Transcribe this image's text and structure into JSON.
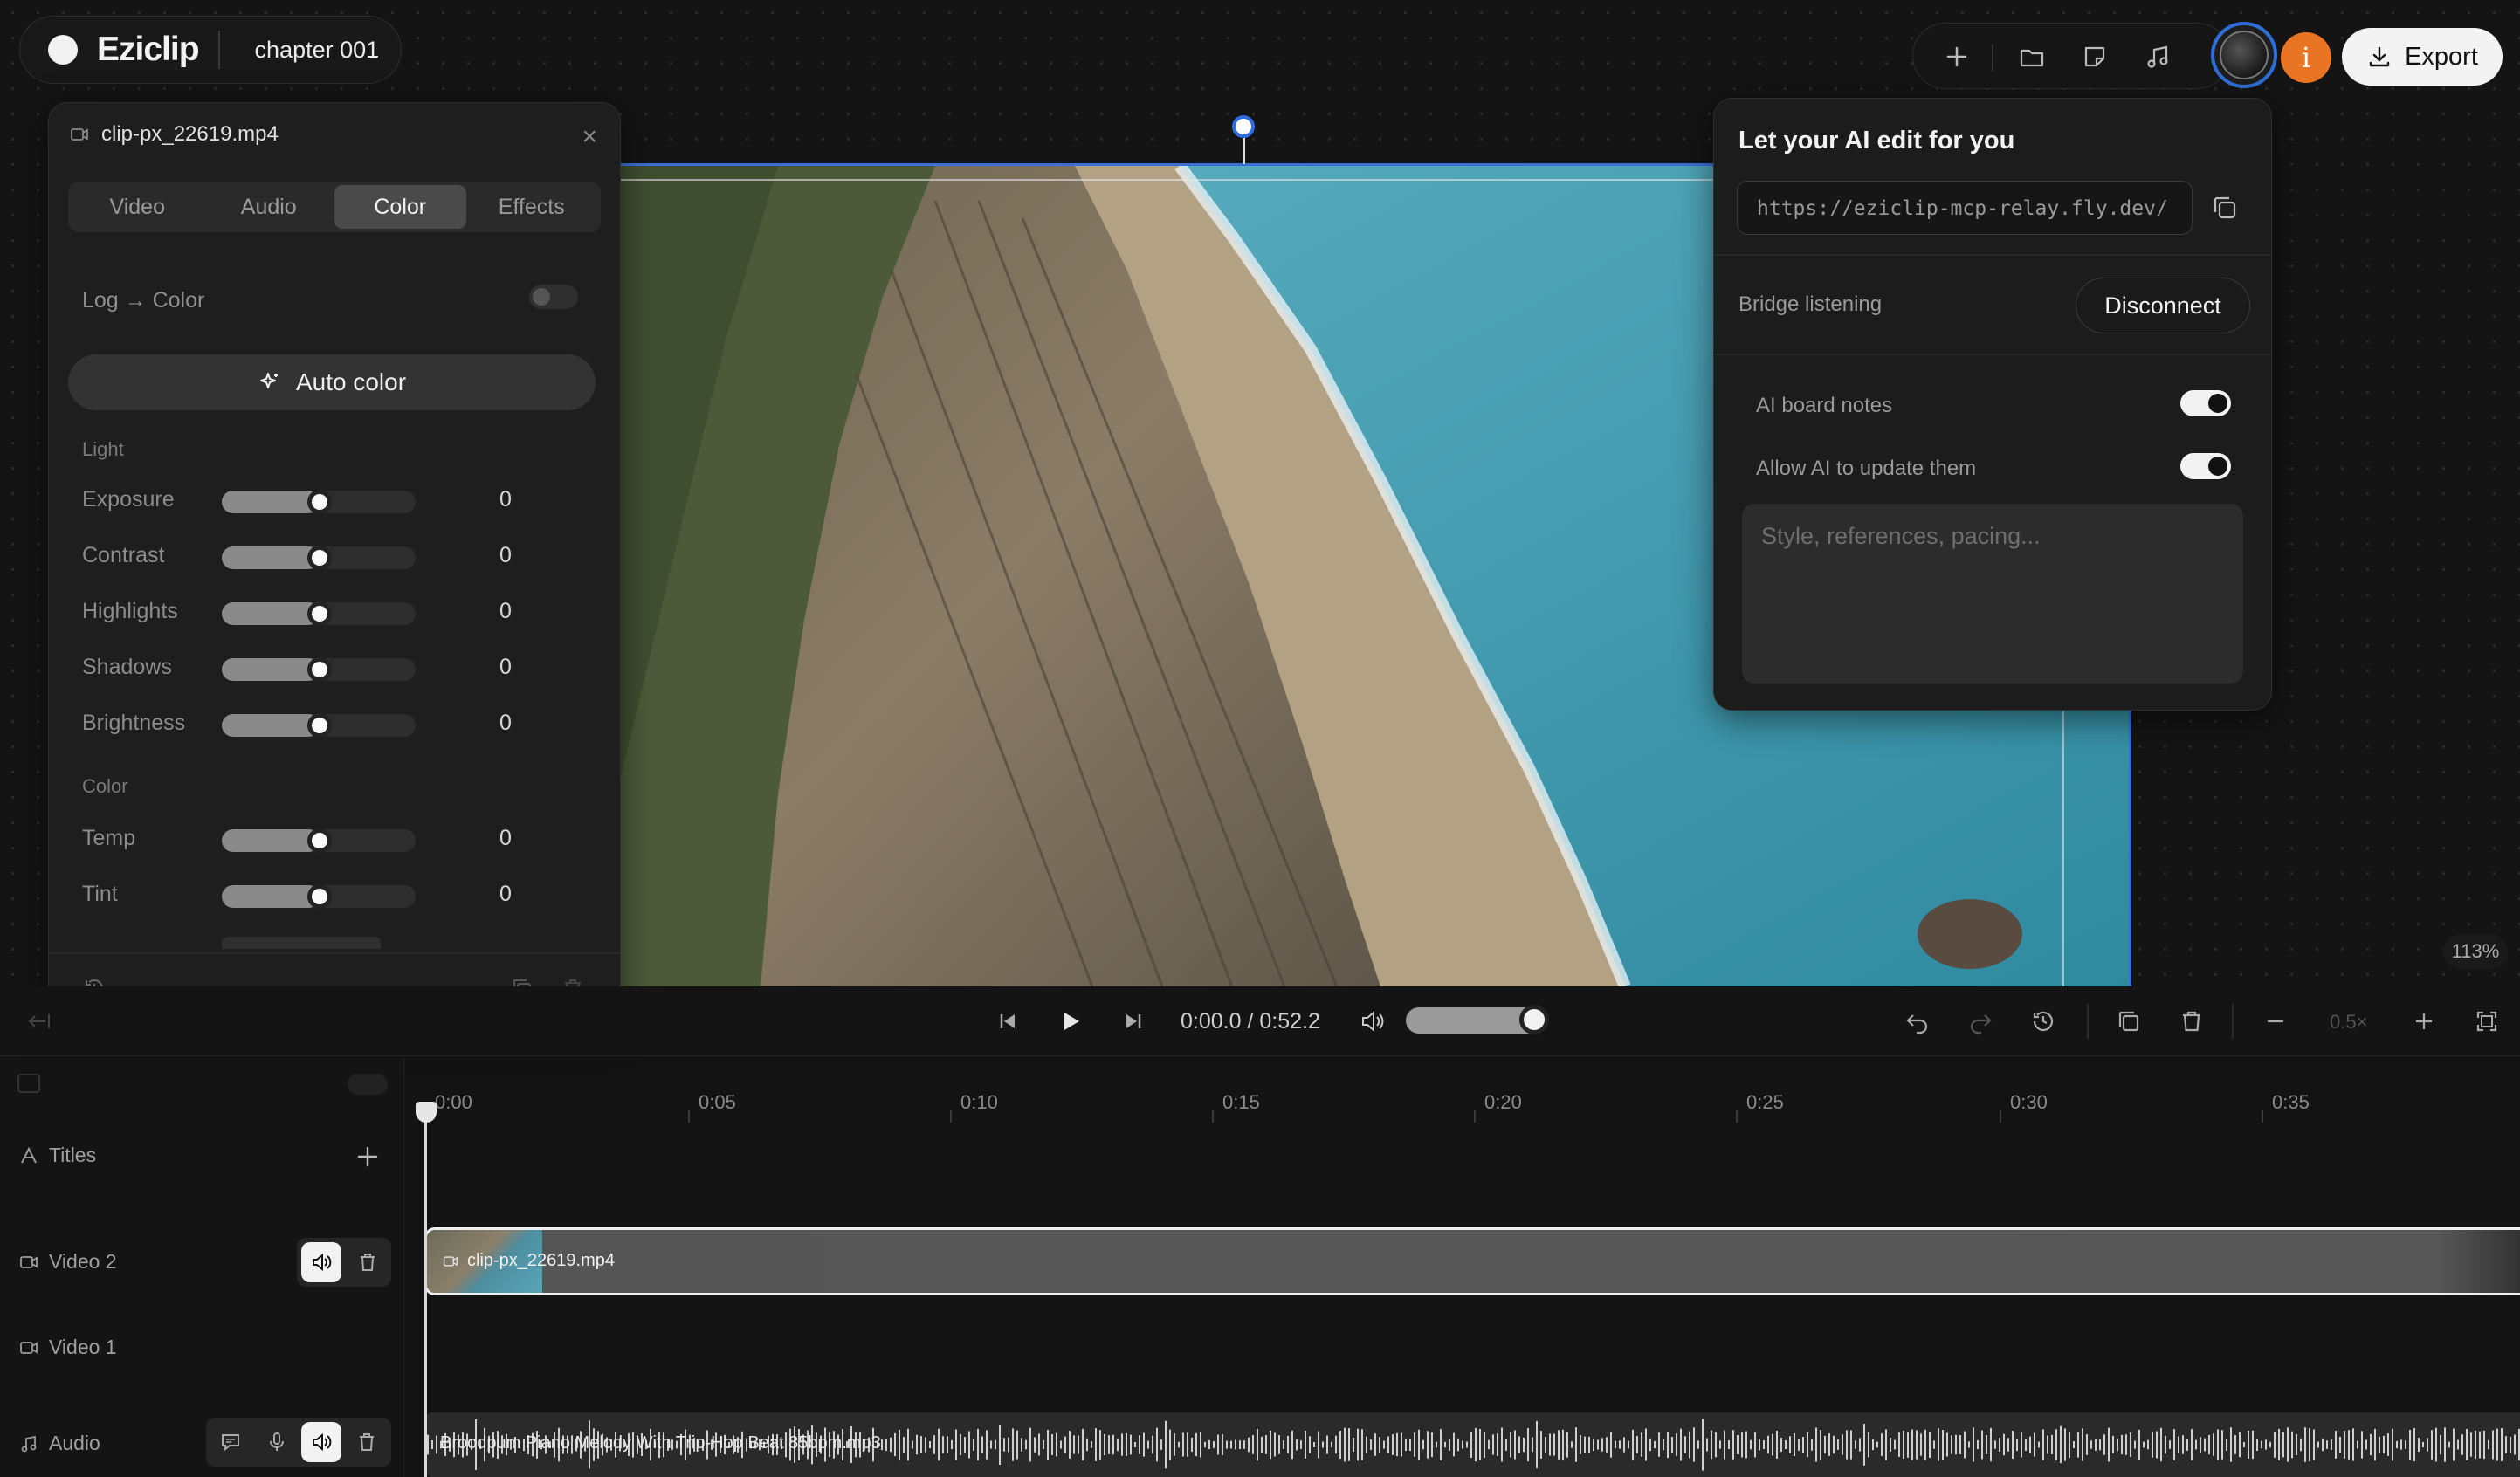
{
  "app": {
    "name": "Eziclip",
    "project": "chapter 001"
  },
  "toolbar": {
    "export_label": "Export",
    "info_label": "i",
    "icons": [
      "plus-icon",
      "folder-icon",
      "sticky-note-icon",
      "music-icon"
    ]
  },
  "clip_panel": {
    "filename": "clip-px_22619.mp4",
    "tabs": [
      {
        "label": "Video"
      },
      {
        "label": "Audio"
      },
      {
        "label": "Color",
        "active": true
      },
      {
        "label": "Effects"
      }
    ],
    "log_label": "Log → Color",
    "auto_color_label": "Auto color",
    "light_section": "Light",
    "light": [
      {
        "label": "Exposure",
        "value": "0"
      },
      {
        "label": "Contrast",
        "value": "0"
      },
      {
        "label": "Highlights",
        "value": "0"
      },
      {
        "label": "Shadows",
        "value": "0"
      },
      {
        "label": "Brightness",
        "value": "0"
      }
    ],
    "color_section": "Color",
    "color": [
      {
        "label": "Temp",
        "value": "0"
      },
      {
        "label": "Tint",
        "value": "0"
      }
    ]
  },
  "ai_panel": {
    "title": "Let your AI edit for you",
    "url": "https://eziclip-mcp-relay.fly.dev/",
    "bridge_status": "Bridge listening",
    "disconnect_label": "Disconnect",
    "board_notes_label": "AI board notes",
    "board_notes_on": true,
    "allow_update_label": "Allow AI to update them",
    "allow_update_on": true,
    "prompt_placeholder": "Style, references, pacing..."
  },
  "viewer": {
    "zoom": "113%"
  },
  "transport": {
    "time": "0:00.0 / 0:52.2",
    "zoom_level": "0.5×"
  },
  "timeline": {
    "ruler": [
      "0:00",
      "0:05",
      "0:10",
      "0:15",
      "0:20",
      "0:25",
      "0:30",
      "0:35"
    ],
    "tracks": [
      {
        "label": "Titles"
      },
      {
        "label": "Video 2"
      },
      {
        "label": "Video 1"
      },
      {
        "label": "Audio"
      }
    ],
    "video_clip": "clip-px_22619.mp4",
    "audio_clip": "Broodpum Piano Melody With Trip-Hop Beat 85bpm.mp3"
  },
  "colors": {
    "accent": "#2e6cdf",
    "info": "#e97524",
    "background": "#141414"
  }
}
